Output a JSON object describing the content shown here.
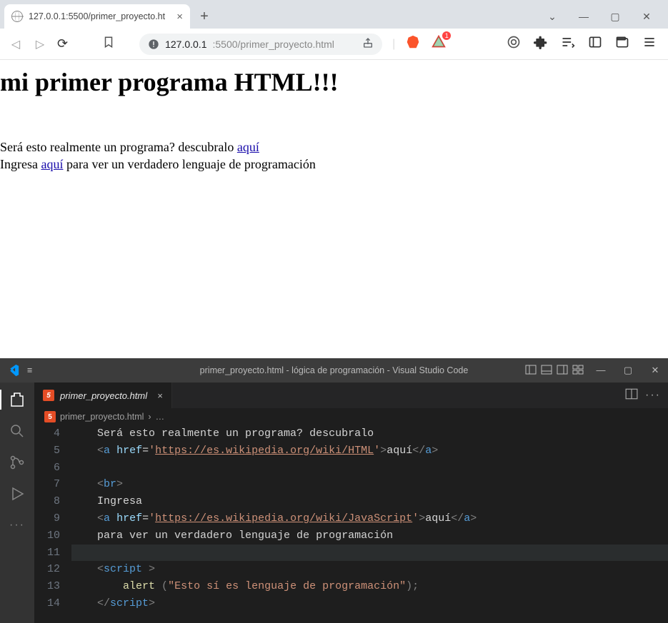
{
  "browser": {
    "tab_title": "127.0.0.1:5500/primer_proyecto.ht",
    "url_host": "127.0.0.1",
    "url_path": ":5500/primer_proyecto.html",
    "brave_badge": "1"
  },
  "page": {
    "heading": "mi primer programa HTML!!!",
    "p1_before": "Será esto realmente un programa? descubralo ",
    "p1_link": "aquí",
    "p2_before": "Ingresa ",
    "p2_link": "aquí",
    "p2_after": " para ver un verdadero lenguaje de programación"
  },
  "vscode": {
    "title": "primer_proyecto.html - lógica de programación - Visual Studio Code",
    "tab": "primer_proyecto.html",
    "breadcrumb_file": "primer_proyecto.html",
    "breadcrumb_more": "…",
    "menu_icon": "≡"
  },
  "code": {
    "start": 4,
    "cur": 11,
    "lines": [
      {
        "n": 4,
        "html": "    <span class='tk-text'>Será esto realmente un programa? descubralo</span>"
      },
      {
        "n": 5,
        "html": "    <span class='tk-brkt'>&lt;</span><span class='tk-tag'>a</span> <span class='tk-attr'>href</span>=<span class='tk-str'>'</span><span class='tk-url'>https://es.wikipedia.org/wiki/HTML</span><span class='tk-str'>'</span><span class='tk-brkt'>&gt;</span><span class='tk-text'>aquí</span><span class='tk-brkt'>&lt;/</span><span class='tk-tag'>a</span><span class='tk-brkt'>&gt;</span>"
      },
      {
        "n": 6,
        "html": ""
      },
      {
        "n": 7,
        "html": "    <span class='tk-brkt'>&lt;</span><span class='tk-tag'>br</span><span class='tk-brkt'>&gt;</span>"
      },
      {
        "n": 8,
        "html": "    <span class='tk-text'>Ingresa</span>"
      },
      {
        "n": 9,
        "html": "    <span class='tk-brkt'>&lt;</span><span class='tk-tag'>a</span> <span class='tk-attr'>href</span>=<span class='tk-str'>'</span><span class='tk-url'>https://es.wikipedia.org/wiki/JavaScript</span><span class='tk-str'>'</span><span class='tk-brkt'>&gt;</span><span class='tk-text'>aquí</span><span class='tk-brkt'>&lt;/</span><span class='tk-tag'>a</span><span class='tk-brkt'>&gt;</span>"
      },
      {
        "n": 10,
        "html": "    <span class='tk-text'>para ver un verdadero lenguaje de programación</span>"
      },
      {
        "n": 11,
        "html": ""
      },
      {
        "n": 12,
        "html": "    <span class='tk-brkt'>&lt;</span><span class='tk-tag'>script </span><span class='tk-brkt'>&gt;</span>"
      },
      {
        "n": 13,
        "html": "        <span class='tk-fn'>alert</span> <span class='tk-brkt'>(</span><span class='tk-str'>\"Esto sí es lenguaje de programación\"</span><span class='tk-brkt'>);</span>"
      },
      {
        "n": 14,
        "html": "    <span class='tk-brkt'>&lt;/</span><span class='tk-tag'>script</span><span class='tk-brkt'>&gt;</span>"
      }
    ]
  }
}
